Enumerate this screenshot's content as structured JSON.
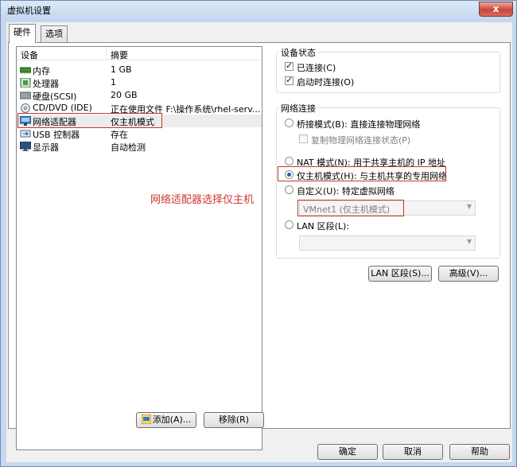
{
  "window": {
    "title": "虚拟机设置",
    "close": "x"
  },
  "tabs": [
    {
      "label": "硬件"
    },
    {
      "label": "选项"
    }
  ],
  "device_list": {
    "headers": {
      "device": "设备",
      "summary": "摘要"
    },
    "rows": [
      {
        "name": "内存",
        "summary": "1 GB",
        "icon": "memory-icon"
      },
      {
        "name": "处理器",
        "summary": "1",
        "icon": "processor-icon"
      },
      {
        "name": "硬盘(SCSI)",
        "summary": "20 GB",
        "icon": "hard-disk-icon"
      },
      {
        "name": "CD/DVD (IDE)",
        "summary": "正在使用文件 F:\\操作系统\\rhel-serv...",
        "icon": "cd-dvd-icon"
      },
      {
        "name": "网络适配器",
        "summary": "仅主机模式",
        "icon": "network-adapter-icon"
      },
      {
        "name": "USB 控制器",
        "summary": "存在",
        "icon": "usb-icon"
      },
      {
        "name": "显示器",
        "summary": "自动检测",
        "icon": "display-icon"
      }
    ]
  },
  "annotation": "网络适配器选择仅主机",
  "buttons": {
    "add": "添加(A)...",
    "remove": "移除(R)",
    "lan_segments": "LAN 区段(S)...",
    "advanced": "高级(V)...",
    "ok": "确定",
    "cancel": "取消",
    "help": "帮助"
  },
  "device_status": {
    "title": "设备状态",
    "connected": {
      "label": "已连接(C)",
      "checked": true
    },
    "connect_at_power_on": {
      "label": "启动时连接(O)",
      "checked": true
    }
  },
  "network_connection": {
    "title": "网络连接",
    "bridged": "桥接模式(B): 直接连接物理网络",
    "replicate": "复制物理网络连接状态(P)",
    "nat": "NAT 模式(N): 用于共享主机的 IP 地址",
    "host_only": "仅主机模式(H): 与主机共享的专用网络",
    "custom": "自定义(U): 特定虚拟网络",
    "custom_value": "VMnet1 (仅主机模式)",
    "lan_segment": "LAN 区段(L):",
    "lan_value": "",
    "selected": "host_only"
  },
  "colors": {
    "annotation": "#d0362f",
    "highlight_border": "#c0392b"
  }
}
